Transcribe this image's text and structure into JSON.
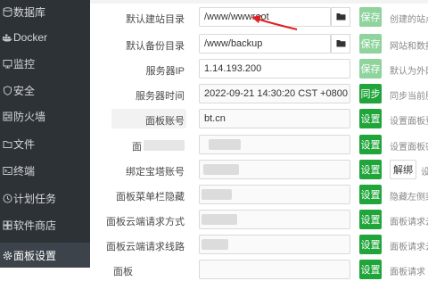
{
  "sidebar": {
    "items": [
      {
        "icon": "database-icon",
        "label": "数据库",
        "active": false
      },
      {
        "icon": "docker-icon",
        "label": "Docker",
        "active": false
      },
      {
        "icon": "monitor-icon",
        "label": "监控",
        "active": false
      },
      {
        "icon": "shield-icon",
        "label": "安全",
        "active": false
      },
      {
        "icon": "firewall-icon",
        "label": "防火墙",
        "active": false
      },
      {
        "icon": "folder-icon",
        "label": "文件",
        "active": false
      },
      {
        "icon": "terminal-icon",
        "label": "终端",
        "active": false
      },
      {
        "icon": "clock-icon",
        "label": "计划任务",
        "active": false
      },
      {
        "icon": "store-icon",
        "label": "软件商店",
        "active": false
      },
      {
        "icon": "gear-icon",
        "label": "面板设置",
        "active": true
      }
    ]
  },
  "settings": {
    "site_dir": {
      "label": "默认建站目录",
      "value": "/www/wwwroot",
      "button": "保存",
      "hint": "创建的站点"
    },
    "backup_dir": {
      "label": "默认备份目录",
      "value": "/www/backup",
      "button": "保存",
      "hint": "网站和数据"
    },
    "server_ip": {
      "label": "服务器IP",
      "value": "1.14.193.200",
      "button": "保存",
      "hint": "默认为外网"
    },
    "server_time": {
      "label": "服务器时间",
      "value": "2022-09-21 14:30:20 CST +0800",
      "button": "同步",
      "hint": "同步当前服"
    },
    "panel_account": {
      "label": "面板账号",
      "value": "bt.cn",
      "button": "设置",
      "hint": "设置面板登"
    },
    "panel_password": {
      "label": "面",
      "value": "",
      "button": "设置",
      "hint": "设置面板密"
    },
    "bind_account": {
      "label": "绑定宝塔账号",
      "value": "",
      "button": "设置",
      "extra_button": "解绑",
      "hint": "设"
    },
    "menu_hide": {
      "label": "面板菜单栏隐藏",
      "value": "",
      "button": "设置",
      "hint": "隐藏左侧菜"
    },
    "cloud_method": {
      "label": "面板云端请求方式",
      "value": "",
      "button": "设置",
      "hint": "面板请求云"
    },
    "cloud_line": {
      "label": "面板云端请求线路",
      "value": "",
      "button": "设置",
      "hint": "面板请求云"
    },
    "last_row": {
      "label": "面板",
      "value": "",
      "button": "设置",
      "hint": "面板请求"
    }
  }
}
